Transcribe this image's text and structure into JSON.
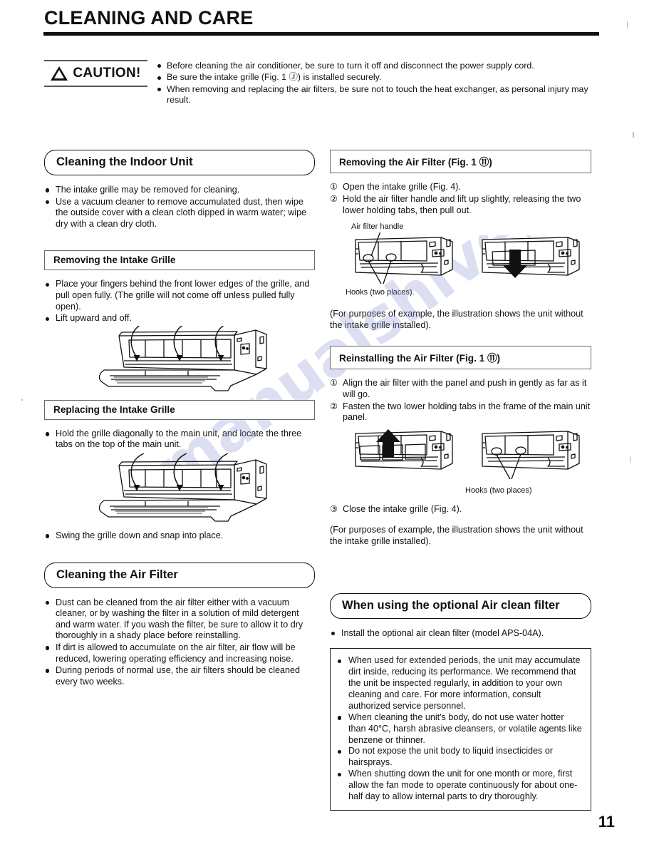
{
  "document": {
    "title": "CLEANING AND CARE",
    "page_number": "11",
    "watermark": "manualshive.co"
  },
  "caution": {
    "label": "CAUTION!",
    "icon": "warning-triangle-icon",
    "items": [
      "Before cleaning the air conditioner, be sure to turn it off and disconnect the power supply cord.",
      "Be sure the intake grille (Fig. 1 Ⓙ) is installed securely.",
      "When removing and replacing the air filters, be sure not to touch the heat exchanger, as personal injury may result."
    ]
  },
  "left_column": {
    "cleaning_indoor_unit": {
      "heading": "Cleaning the Indoor Unit",
      "bullets": [
        "The intake grille may be removed for cleaning.",
        "Use a vacuum cleaner to remove accumulated dust, then wipe the outside cover with a clean cloth dipped in warm water; wipe dry with a clean dry cloth."
      ]
    },
    "removing_intake_grille": {
      "heading": "Removing the Intake Grille",
      "bullets": [
        "Place your fingers behind the front lower edges of the grille, and pull open fully. (The grille will not come off unless pulled fully open).",
        "Lift upward and off."
      ],
      "figure_name": "indoor-unit-grille-removal-illustration"
    },
    "replacing_intake_grille": {
      "heading": "Replacing the Intake Grille",
      "bullets_before": [
        "Hold the grille diagonally to the main unit, and locate the three tabs on the top of the main unit."
      ],
      "bullets_after": [
        "Swing the grille down and snap into place."
      ],
      "figure_name": "indoor-unit-grille-replacement-illustration"
    },
    "cleaning_air_filter": {
      "heading": "Cleaning the Air Filter",
      "bullets": [
        "Dust can be cleaned from the air filter either with a vacuum cleaner, or by washing the filter in a solution of mild detergent and warm water. If you wash the filter, be sure to allow it to dry thoroughly in a shady place before reinstalling.",
        "If dirt is allowed to accumulate on the air filter, air flow will be reduced, lowering operating efficiency and increasing noise.",
        "During periods of normal use, the air filters should be cleaned every two weeks."
      ]
    }
  },
  "right_column": {
    "removing_air_filter": {
      "heading": "Removing the Air Filter (Fig. 1 Ⓙ1)",
      "heading_text": "Removing the Air Filter (Fig. 1 ⑪)",
      "steps": [
        {
          "num": "①",
          "text": "Open the intake grille (Fig. 4)."
        },
        {
          "num": "②",
          "text": "Hold the air filter handle and lift up slightly, releasing the two lower holding tabs, then pull out."
        }
      ],
      "figure_labels": {
        "handle": "Air filter handle",
        "hooks": "Hooks (two places)."
      },
      "note": "(For purposes of example, the illustration shows the unit without the intake grille installed)."
    },
    "reinstalling_air_filter": {
      "heading_text": "Reinstalling the Air Filter (Fig. 1 ⑪)",
      "steps": [
        {
          "num": "①",
          "text": "Align the air filter with the panel and push in gently as far as it will go."
        },
        {
          "num": "②",
          "text": "Fasten the two lower holding tabs in the frame of the main unit panel."
        }
      ],
      "figure_labels": {
        "hooks": "Hooks (two places)"
      },
      "step3": {
        "num": "③",
        "text": "Close the intake grille (Fig. 4)."
      },
      "note": "(For purposes of example, the illustration shows the unit without the intake grille installed)."
    },
    "air_clean_filter": {
      "heading": "When using the optional Air clean filter",
      "bullets": [
        "Install the optional air clean filter (model APS-04A)."
      ],
      "warnings": [
        "When used for extended periods, the unit may accumulate dirt inside, reducing its performance.  We recommend that the unit be inspected regularly, in addition to your own cleaning and care. For more information, consult authorized service personnel.",
        "When cleaning the unit's body, do not use water hotter than 40°C,  harsh abrasive cleansers, or volatile agents like benzene or thinner.",
        "Do not expose the unit body to liquid insecticides or hairsprays.",
        "When shutting down the unit for one month or more, first allow the fan mode to operate continuously for about one-half day to allow internal parts to dry thoroughly."
      ]
    }
  }
}
